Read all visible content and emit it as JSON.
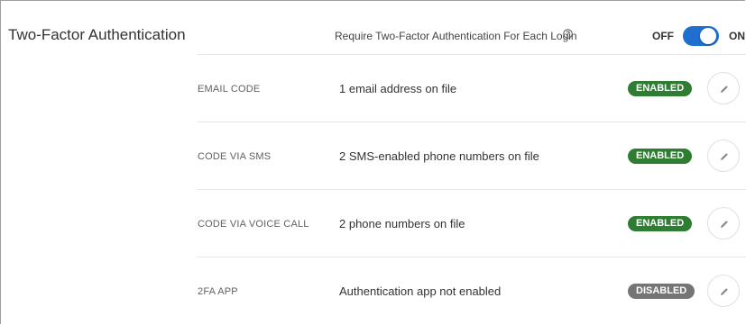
{
  "header": {
    "title": "Two-Factor Authentication",
    "require_text": "Require Two-Factor Authentication For Each Login",
    "help_icon": "help-circle-icon",
    "toggle": {
      "off_label": "OFF",
      "on_label": "ON",
      "state": "on",
      "color": "#1e6fd0"
    }
  },
  "methods": [
    {
      "name": "EMAIL CODE",
      "description": "1 email address on file",
      "status": "ENABLED"
    },
    {
      "name": "CODE VIA SMS",
      "description": "2 SMS-enabled phone numbers on file",
      "status": "ENABLED"
    },
    {
      "name": "CODE VIA VOICE CALL",
      "description": "2 phone numbers on file",
      "status": "ENABLED"
    },
    {
      "name": "2FA APP",
      "description": "Authentication app not enabled",
      "status": "DISABLED"
    }
  ],
  "colors": {
    "enabled": "#2e7d32",
    "disabled": "#757575"
  },
  "edit_icon": "pencil-icon"
}
